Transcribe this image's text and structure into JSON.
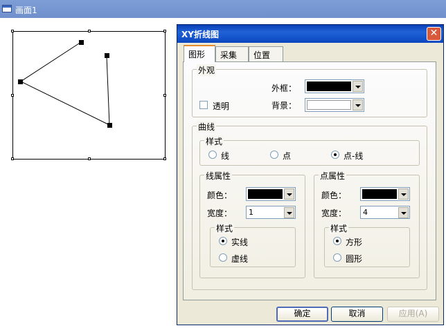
{
  "background_window": {
    "title": "画面1"
  },
  "dialog": {
    "title": "XY折线图",
    "tabs": [
      {
        "label": "图形",
        "active": true
      },
      {
        "label": "采集",
        "active": false
      },
      {
        "label": "位置",
        "active": false
      }
    ],
    "appearance": {
      "group_title": "外观",
      "transparent_label": "透明",
      "transparent_checked": false,
      "frame_label": "外框：",
      "frame_color": "#000000",
      "background_label": "背景：",
      "background_color": "#ffffff"
    },
    "curve": {
      "group_title": "曲线",
      "style": {
        "group_title": "样式",
        "options": [
          "线",
          "点",
          "点-线"
        ],
        "selected": "点-线"
      },
      "line_props": {
        "group_title": "线属性",
        "color_label": "颜色：",
        "color": "#000000",
        "width_label": "宽度：",
        "width_value": "1",
        "style_group_title": "样式",
        "style_options": [
          "实线",
          "虚线"
        ],
        "style_selected": "实线"
      },
      "point_props": {
        "group_title": "点属性",
        "color_label": "颜色：",
        "color": "#000000",
        "width_label": "宽度：",
        "width_value": "4",
        "style_group_title": "样式",
        "style_options": [
          "方形",
          "圆形"
        ],
        "style_selected": "方形"
      }
    },
    "buttons": {
      "ok": "确定",
      "cancel": "取消",
      "apply": "应用(A)"
    }
  },
  "colors": {
    "titlebar_active": "#0a3fb6",
    "titlebar_inactive": "#7e9ed6",
    "dialog_face": "#ece9d8",
    "close_button": "#d95a3b"
  }
}
